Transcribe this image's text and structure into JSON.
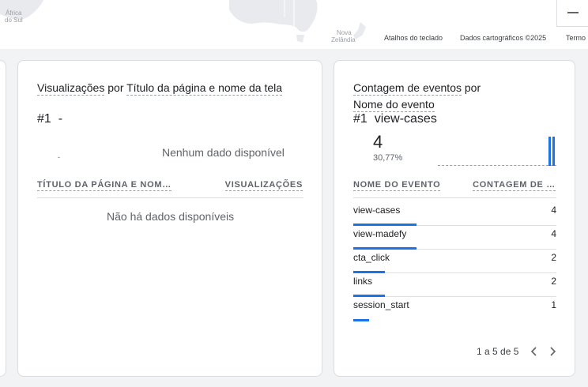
{
  "map": {
    "label_africa": "África",
    "label_africa_sul": "do Sul",
    "label_nz_1": "Nova",
    "label_nz_2": "Zelândia",
    "footer_keyboard": "Atalhos do teclado",
    "footer_data": "Dados cartográficos ©2025",
    "footer_terms": "Termo"
  },
  "views_card": {
    "title_part1": "Visualizações",
    "title_connector": " por ",
    "title_part2": "Título da página e nome da tela",
    "rank_label": "#1",
    "rank_value": "-",
    "small_dash": "-",
    "no_data_chart": "Nenhum dado disponível",
    "col_name": "TÍTULO DA PÁGINA E NOM…",
    "col_value": "VISUALIZAÇÕES",
    "no_data_table": "Não há dados disponíveis"
  },
  "events_card": {
    "title_part1": "Contagem de eventos",
    "title_connector": " por",
    "title_part2": "Nome do evento",
    "rank_label": "#1",
    "rank_value": "view-cases",
    "big_number": "4",
    "percent": "30,77%",
    "col_name": "NOME DO EVENTO",
    "col_value": "CONTAGEM DE …",
    "rows": [
      {
        "name": "view-cases",
        "value": "4",
        "count": 4
      },
      {
        "name": "view-madefy",
        "value": "4",
        "count": 4
      },
      {
        "name": "cta_click",
        "value": "2",
        "count": 2
      },
      {
        "name": "links",
        "value": "2",
        "count": 2
      },
      {
        "name": "session_start",
        "value": "1",
        "count": 1
      }
    ],
    "max_count": 4,
    "pager_text": "1 a 5 de 5"
  },
  "colors": {
    "accent": "#1a73e8",
    "map_land": "#e8eaed"
  }
}
